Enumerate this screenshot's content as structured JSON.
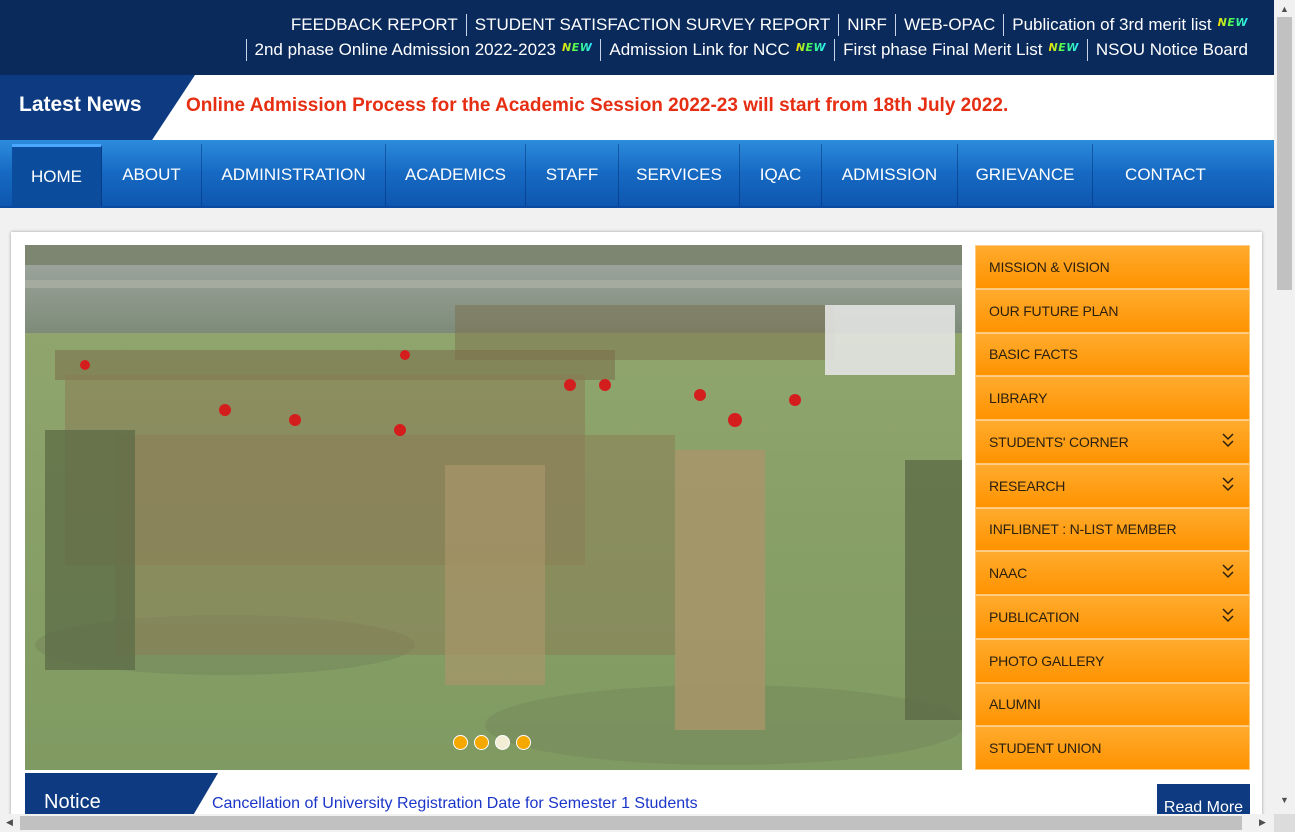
{
  "topbar": {
    "row1": [
      {
        "label": "FEEDBACK REPORT",
        "new": false
      },
      {
        "label": "STUDENT SATISFACTION SURVEY REPORT",
        "new": false
      },
      {
        "label": "NIRF",
        "new": false
      },
      {
        "label": "WEB-OPAC",
        "new": false
      },
      {
        "label": "Publication of 3rd merit list",
        "new": true
      }
    ],
    "row2": [
      {
        "label": "2nd phase Online Admission 2022-2023",
        "new": true
      },
      {
        "label": "Admission Link for NCC",
        "new": true
      },
      {
        "label": "First phase Final Merit List",
        "new": true
      },
      {
        "label": "NSOU Notice Board",
        "new": false
      }
    ],
    "new_badge": "NEW"
  },
  "news": {
    "label": "Latest News",
    "text": "Online Admission Process for the Academic Session 2022-23 will start from 18th July 2022."
  },
  "nav": {
    "items": [
      "HOME",
      "ABOUT",
      "ADMINISTRATION",
      "ACADEMICS",
      "STAFF",
      "SERVICES",
      "IQAC",
      "ADMISSION",
      "GRIEVANCE",
      "CONTACT"
    ],
    "active": "HOME"
  },
  "slider": {
    "active_dot": 3,
    "dot_count": 4
  },
  "sidebar": {
    "items": [
      {
        "label": "MISSION & VISION",
        "expand": false
      },
      {
        "label": "OUR FUTURE PLAN",
        "expand": false
      },
      {
        "label": "BASIC FACTS",
        "expand": false
      },
      {
        "label": "LIBRARY",
        "expand": false
      },
      {
        "label": "STUDENTS' CORNER",
        "expand": true
      },
      {
        "label": "RESEARCH",
        "expand": true
      },
      {
        "label": "INFLIBNET : N-LIST MEMBER",
        "expand": false
      },
      {
        "label": "NAAC",
        "expand": true
      },
      {
        "label": "PUBLICATION",
        "expand": true
      },
      {
        "label": "PHOTO GALLERY",
        "expand": false
      },
      {
        "label": "ALUMNI",
        "expand": false
      },
      {
        "label": "STUDENT UNION",
        "expand": false
      }
    ]
  },
  "notice": {
    "label": "Notice",
    "text": "Cancellation of University Registration Date for Semester 1 Students",
    "read_more": "Read More"
  },
  "colors": {
    "topbar_bg": "#0a2a5c",
    "news_red": "#e62e13",
    "nav_blue": "#1669c2",
    "sidebar_orange": "#ff9a14",
    "notice_link": "#1a35c9"
  }
}
